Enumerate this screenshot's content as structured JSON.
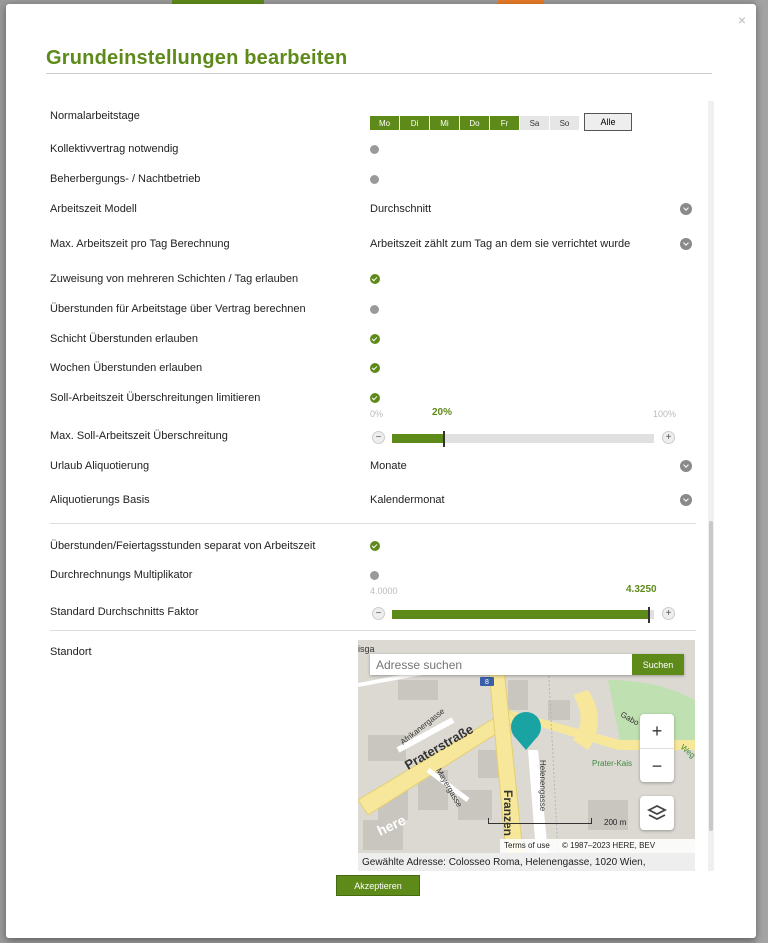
{
  "dialog": {
    "title": "Grundeinstellungen bearbeiten",
    "close_glyph": "×",
    "accept_label": "Akzeptieren"
  },
  "settings": {
    "workdays": {
      "label": "Normalarbeitstage",
      "days": [
        {
          "label": "Mo",
          "active": true
        },
        {
          "label": "Di",
          "active": true
        },
        {
          "label": "Mi",
          "active": true
        },
        {
          "label": "Do",
          "active": true
        },
        {
          "label": "Fr",
          "active": true
        },
        {
          "label": "Sa",
          "active": false
        },
        {
          "label": "So",
          "active": false
        }
      ],
      "all_label": "Alle"
    },
    "collective": {
      "label": "Kollektivvertrag notwendig",
      "enabled": false
    },
    "accommodation": {
      "label": "Beherbergungs- / Nachtbetrieb",
      "enabled": false
    },
    "worktime_model": {
      "label": "Arbeitszeit Modell",
      "value": "Durchschnitt"
    },
    "max_per_day": {
      "label": "Max. Arbeitszeit pro Tag Berechnung",
      "value": "Arbeitszeit zählt zum Tag an dem sie verrichtet wurde"
    },
    "multi_shift": {
      "label": "Zuweisung von mehreren Schichten / Tag erlauben",
      "enabled": true
    },
    "overtime_workdays": {
      "label": "Überstunden für Arbeitstage über Vertrag berechnen",
      "enabled": false
    },
    "shift_overtime": {
      "label": "Schicht Überstunden erlauben",
      "enabled": true
    },
    "week_overtime": {
      "label": "Wochen Überstunden erlauben",
      "enabled": true
    },
    "limit_exceed": {
      "label": "Soll-Arbeitszeit Überschreitungen limitieren",
      "enabled": true
    },
    "max_exceed": {
      "label": "Max. Soll-Arbeitszeit Überschreitung",
      "min_label": "0%",
      "max_label": "100%",
      "current_label": "20%",
      "value": 0.2
    },
    "vacation": {
      "label": "Urlaub Aliquotierung",
      "value": "Monate"
    },
    "aliquot_basis": {
      "label": "Aliquotierungs Basis",
      "value": "Kalendermonat"
    },
    "overtime_separate": {
      "label": "Überstunden/Feiertagsstunden separat von Arbeitszeit",
      "enabled": true
    },
    "multiplier": {
      "label": "Durchrechnungs Multiplikator",
      "enabled": false
    },
    "avg_factor": {
      "label": "Standard Durchschnitts Faktor",
      "min_label": "4.0000",
      "current_label": "4.3250",
      "value": 0.98
    },
    "location": {
      "label": "Standort",
      "search_placeholder": "Adresse suchen",
      "search_button": "Suchen",
      "streets": [
        "Praterstraße",
        "Afrikanergasse",
        "Mayergasse",
        "Helenengasse",
        "Franzen",
        "Prater-Kais",
        "Gabo",
        "Weg",
        "isga",
        "here"
      ],
      "metro_label": "8",
      "scale_label": "200 m",
      "terms": "Terms of use",
      "copyright": "© 1987–2023 HERE, BEV",
      "selected_address": "Gewählte Adresse: Colosseo Roma, Helenengasse, 1020 Wien,"
    }
  },
  "colors": {
    "accent": "#5e8a1a",
    "inactive": "#9a9a9a",
    "pin": "#1aa3a3"
  }
}
